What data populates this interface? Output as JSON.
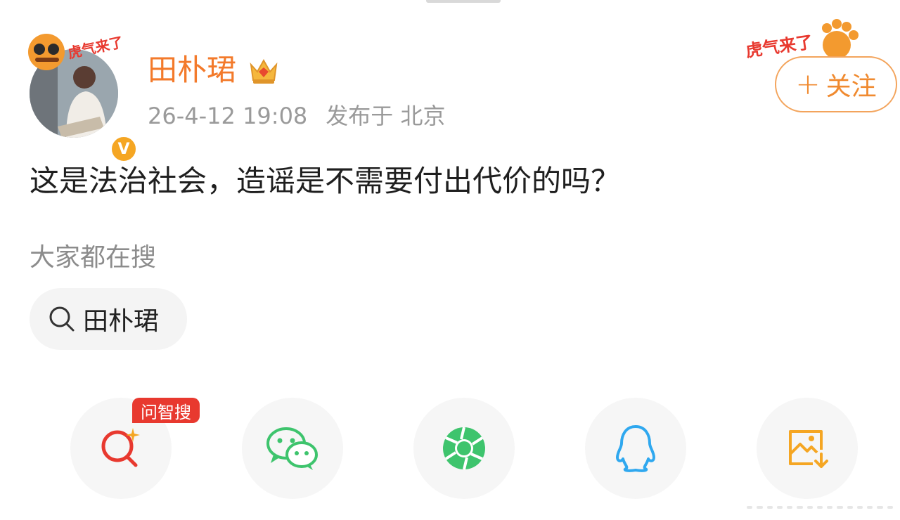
{
  "post": {
    "author": "田朴珺",
    "time": "26-4-12 19:08",
    "location": "发布于 北京",
    "content": "这是法治社会，造谣是不需要付出代价的吗？",
    "avatar_deco_text": "虎气来了",
    "verified_badge": "V"
  },
  "follow": {
    "plus": "+",
    "label": "关注",
    "deco_text": "虎气来了"
  },
  "search": {
    "hint": "大家都在搜",
    "chip": "田朴珺"
  },
  "share": {
    "badge": "问智搜",
    "items": [
      {
        "icon": "ai-search-icon"
      },
      {
        "icon": "wechat-icon"
      },
      {
        "icon": "moments-icon"
      },
      {
        "icon": "qq-icon"
      },
      {
        "icon": "save-image-icon"
      }
    ]
  },
  "colors": {
    "accent_orange": "#f37a2b",
    "badge_red": "#e8392f",
    "wechat_green": "#3ec46d",
    "qq_blue": "#2fa8ef",
    "save_orange": "#f5a623"
  }
}
